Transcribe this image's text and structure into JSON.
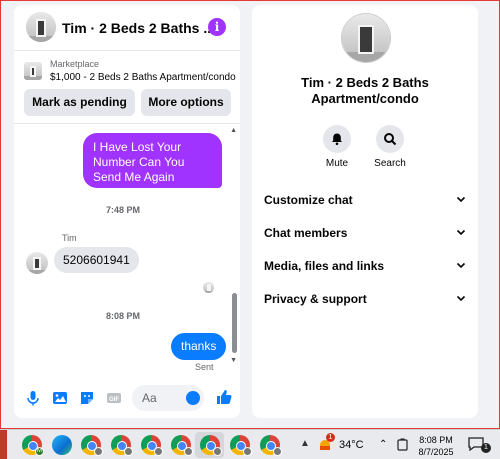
{
  "chat": {
    "title": "Tim · 2 Beds 2 Baths ...",
    "marketplace_label": "Marketplace",
    "listing": "$1,000 - 2 Beds 2 Baths Apartment/condo",
    "mark_pending_label": "Mark as pending",
    "more_options_label": "More options",
    "messages": {
      "outgoing_1": "I Have Lost Your Number Can You Send Me Again",
      "time_1": "7:48 PM",
      "sender_name": "Tim",
      "incoming_1": "5206601941",
      "time_2": "8:08 PM",
      "outgoing_2": "thanks",
      "status": "Sent"
    },
    "composer_placeholder": "Aa"
  },
  "info": {
    "name": "Tim · 2 Beds 2 Baths Apartment/condo",
    "mute_label": "Mute",
    "search_label": "Search",
    "sections": [
      "Customize chat",
      "Chat members",
      "Media, files and links",
      "Privacy & support"
    ]
  },
  "taskbar": {
    "temperature": "34°C",
    "weather_badge": "1",
    "time": "8:08 PM",
    "date": "8/7/2025",
    "notification_count": "1"
  },
  "colors": {
    "accent_purple": "#a033ff",
    "messenger_blue": "#0a7cff",
    "panel_bg": "#f0f2f5"
  }
}
